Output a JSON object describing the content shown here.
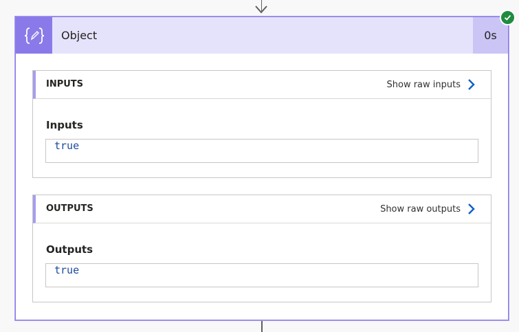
{
  "action": {
    "title": "Object",
    "duration": "0s",
    "status": "succeeded",
    "icon": "braces-pencil-icon",
    "colors": {
      "icon_bg": "#8a7ae9",
      "header_bg": "#e5e3fb",
      "duration_bg": "#cbc5f5",
      "success": "#1f8b3f"
    }
  },
  "inputs": {
    "title": "INPUTS",
    "raw_link": "Show raw inputs",
    "field_label": "Inputs",
    "value": "true"
  },
  "outputs": {
    "title": "OUTPUTS",
    "raw_link": "Show raw outputs",
    "field_label": "Outputs",
    "value": "true"
  }
}
